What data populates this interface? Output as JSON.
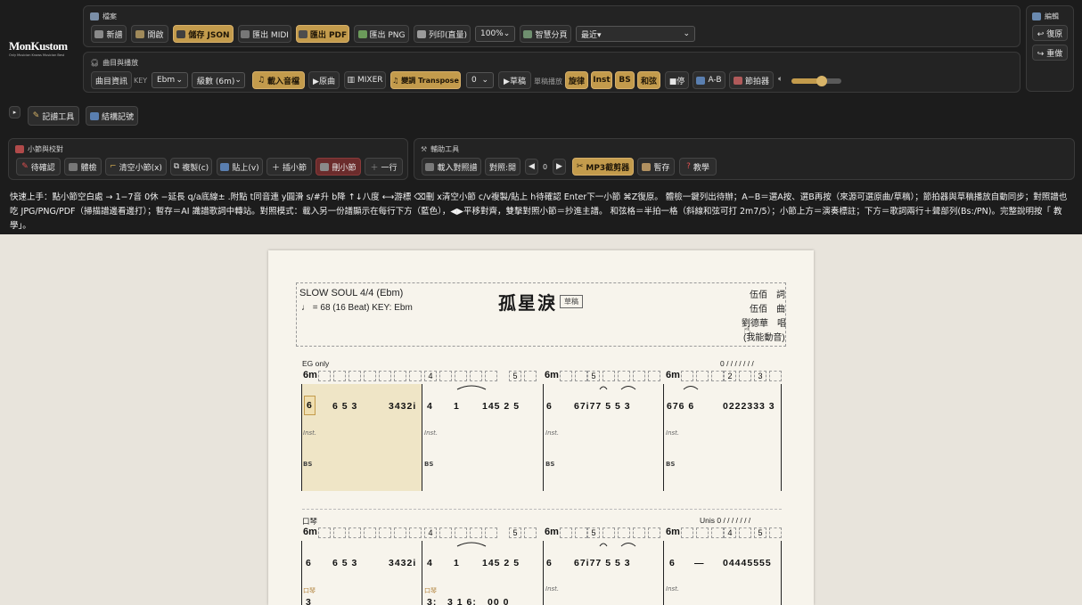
{
  "brand": {
    "name": "MonKustom",
    "tagline": "Only Musician Knows Musician Best"
  },
  "file_panel": {
    "title": "檔案",
    "buttons": {
      "new": "新譜",
      "open": "開啟",
      "save_json": "儲存 JSON",
      "export_midi": "匯出 MIDI",
      "export_pdf": "匯出 PDF",
      "export_png": "匯出 PNG",
      "print": "列印(直量)",
      "smart_page": "智慧分頁"
    },
    "zoom": "100%",
    "recent": "最近▾"
  },
  "edit_panel": {
    "title": "編輯",
    "undo": "↩ 復原",
    "redo": "↪ 重做"
  },
  "playback_panel": {
    "title": "曲目與播放",
    "song_info": "曲目資訊",
    "key_label": "KEY",
    "key": "Ebm",
    "level": "級數 (6m)",
    "load_audio": "載入音檔",
    "play_original": "▶原曲",
    "mixer": "MIXER",
    "transpose": "變調 Transpose",
    "transpose_value": "0",
    "play_score": "▶草稿",
    "score_play_label": "單稿播放",
    "melody": "旋律",
    "inst": "Inst",
    "bs": "BS",
    "chord": "和弦",
    "stop": "■停",
    "ab": "A-B",
    "metronome": "節拍器",
    "volume": 0.6
  },
  "record_tools": {
    "label": "記譜工具"
  },
  "structure": {
    "label": "結構記號"
  },
  "measure_panel": {
    "title": "小節與校對",
    "buttons": {
      "pending": "待確認",
      "rest": "體檢",
      "clear_measure": "清空小節(x)",
      "copy": "複製(c)",
      "paste": "貼上(v)",
      "insert_measure": "插小節",
      "delete_measure": "刪小節",
      "row": "一行"
    }
  },
  "aux_panel": {
    "title": "輔助工具",
    "load_ref": "載入對照譜",
    "compare": "對照:開",
    "nav_value": "0",
    "mp3_cutter": "MP3截剪器",
    "save_draft": "暫存",
    "tutorial": "教學"
  },
  "help_text": "快速上手：點小節空白處 → 1−7音 0休 −延長 q/a底線± .附點 t同音連 y圓滑 s/#升 b降 ↑↓八度 ⟷游標 ⌫刪 x清空小節 c/v複製/貼上 h待確認 Enter下一小節 ⌘Z復原。 體檢一鍵列出待辦；A−B＝選A按、選B再按（來源可選原曲/草稿）；節拍器與草稿播放自動同步；對照譜也吃 JPG/PNG/PDF（掃描譜邊看邊打）；暫存＝AI 識譜歌詞中轉站。對照模式：載入另一份譜顯示在每行下方（藍色），◀▶平移對齊，雙擊對照小節＝抄進主譜。 和弦格＝半拍一格（斜線和弦可打 2m7/5）；小節上方＝演奏標註；下方＝歌詞兩行＋聲部列(Bs:/PN)。完整說明按「 教學」。",
  "score": {
    "style_line": "SLOW SOUL 4/4 (Ebm)",
    "tempo_line": "♩ = 68 (16 Beat)   KEY: Ebm",
    "title": "孤星淚",
    "tag": "草稿",
    "credits": [
      "伍佰　詞",
      "伍佰　曲",
      "劉德華　唱",
      "(我能動音)"
    ],
    "row1": {
      "label": "EG only",
      "right_label": "0 / / /   / / / /",
      "chords": [
        "6m",
        "4",
        "5",
        "6m",
        "5",
        "6m",
        "2",
        "3"
      ],
      "notes": [
        "6",
        "6  5  3",
        "3432i",
        "4",
        "1",
        "145  2  5",
        "6",
        "67i77  5  5  3",
        "676  6",
        "0222333 3"
      ],
      "inst": "Inst.",
      "bs": "BS"
    },
    "row2": {
      "label": "口琴",
      "right_label": "Unis  0 / / /   / / / /",
      "chords": [
        "6m",
        "4",
        "5",
        "6m",
        "5",
        "6m",
        "4",
        "5"
      ],
      "notes": [
        "6",
        "6  5  3",
        "3432i",
        "4",
        "1",
        "145  2  5",
        "6",
        "67i77  5  5  3",
        "6",
        "—",
        "04445555"
      ],
      "inst": "Inst.",
      "sub_label": "口琴",
      "bottom": [
        "3",
        "3:",
        "3 1  6:",
        "00  0"
      ]
    }
  }
}
